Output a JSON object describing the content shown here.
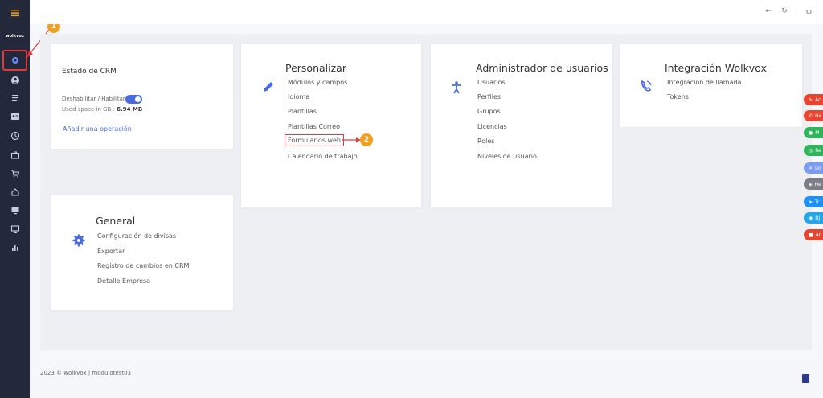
{
  "colors": {
    "sidebar_bg": "#23283a",
    "accent": "#4a6bdf",
    "annotation": "#f0a020",
    "highlight_border": "#e23a3a"
  },
  "sidebar": {
    "logo_text": "wolkvox",
    "items": [
      {
        "name": "menu-icon"
      },
      {
        "name": "settings-icon"
      },
      {
        "name": "user-icon"
      },
      {
        "name": "list-icon"
      },
      {
        "name": "contact-card-icon"
      },
      {
        "name": "history-icon"
      },
      {
        "name": "briefcase-icon"
      },
      {
        "name": "cart-icon"
      },
      {
        "name": "home-icon"
      },
      {
        "name": "monitor-icon"
      },
      {
        "name": "presentation-icon"
      },
      {
        "name": "chart-icon"
      }
    ]
  },
  "annotations": {
    "step1": "1",
    "step2": "2"
  },
  "crm_card": {
    "title": "Estado de CRM",
    "toggle_label": "Deshabilitar / Habilitar",
    "used_space_label": "Used space in GB :",
    "used_space_value": "6.94 MB",
    "add_operation": "Añadir una operación"
  },
  "personalizar": {
    "title": "Personalizar",
    "icon": "pencil-icon",
    "links": [
      "Módulos y campos",
      "Idioma",
      "Plantillas",
      "Plantillas Correo",
      "Formularios web",
      "Calendario de trabajo"
    ]
  },
  "admin_usuarios": {
    "title": "Administrador de usuarios",
    "icon": "accessibility-icon",
    "links": [
      "Usuarios",
      "Perfiles",
      "Grupos",
      "Licencias",
      "Roles",
      "Niveles de usuario"
    ]
  },
  "integracion": {
    "title": "Integración Wolkvox",
    "icon": "phone-icon",
    "links": [
      "Integración de llamada",
      "Tokens"
    ]
  },
  "general": {
    "title": "General",
    "icon": "gear-icon",
    "links": [
      "Configuración de divisas",
      "Exportar",
      "Registro de cambios en CRM",
      "Detalle Empresa"
    ]
  },
  "footer": {
    "text": "2023 © wolkvox | modulotest03"
  },
  "side_buttons": [
    {
      "label": "Ac",
      "color": "#e8442f"
    },
    {
      "label": "He",
      "color": "#e8442f"
    },
    {
      "label": "M",
      "color": "#2fb45a"
    },
    {
      "label": "Re",
      "color": "#2fb45a"
    },
    {
      "label": "Lo",
      "color": "#7b9cf0"
    },
    {
      "label": "He",
      "color": "#7a7f87"
    },
    {
      "label": "Tr",
      "color": "#1f8ff0"
    },
    {
      "label": "BJ",
      "color": "#24a6e8"
    },
    {
      "label": "Ac",
      "color": "#e8442f"
    }
  ]
}
